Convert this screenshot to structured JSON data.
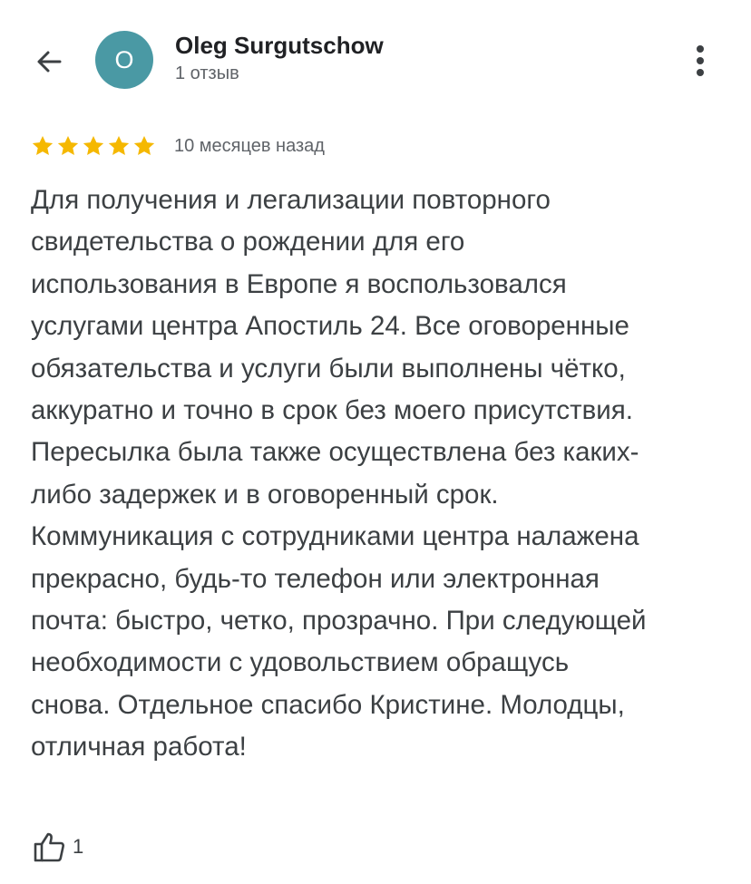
{
  "header": {
    "back_icon": "arrow-back-icon",
    "avatar_letter": "O",
    "avatar_color": "#4a99a4",
    "user_name": "Oleg Surgutschow",
    "review_count": "1 отзыв",
    "more_icon": "more-vert-icon"
  },
  "review": {
    "rating": 5,
    "rating_max": 5,
    "star_color": "#f5b800",
    "date": "10 месяцев назад",
    "text_lines": [
      "Для получения и легализации повторного",
      "свидетельства о рождении для его",
      "использования в Европе я воспользовался",
      "услугами центра Апостиль 24. Все оговоренные",
      "обязательства и услуги были выполнены чётко,",
      "аккуратно и точно в срок без моего присутствия.",
      "Пересылка была также осуществлена без каких-",
      "либо задержек и в оговоренный срок.",
      "Коммуникация с сотрудниками центра налажена",
      "прекрасно, будь-то телефон или электронная",
      "почта: быстро, четко, прозрачно. При следующей",
      "необходимости с удовольствием обращусь",
      "снова. Отдельное спасибо Кристине. Молодцы,",
      "отличная работа!"
    ]
  },
  "actions": {
    "like_icon": "thumb-up-icon",
    "like_count": "1"
  }
}
